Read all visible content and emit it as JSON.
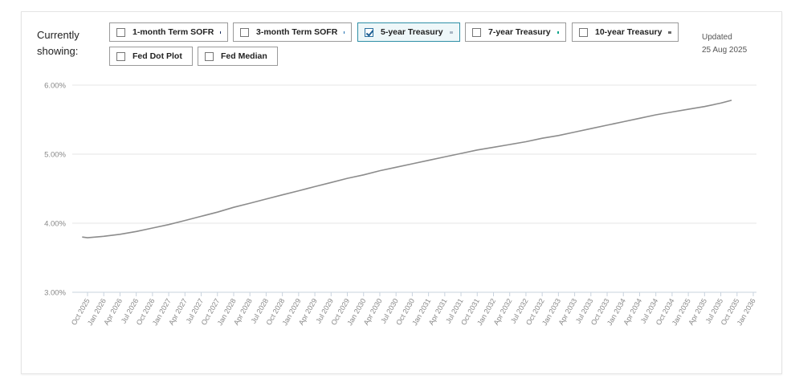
{
  "header": {
    "label_line1": "Currently",
    "label_line2": "showing:",
    "updated_label": "Updated",
    "updated_date": "25 Aug 2025"
  },
  "legend": [
    {
      "label": "1-month Term SOFR",
      "checked": false,
      "marker": "line",
      "color": "#1b2f5e"
    },
    {
      "label": "3-month Term SOFR",
      "checked": false,
      "marker": "line",
      "color": "#1f6fb0"
    },
    {
      "label": "5-year Treasury",
      "checked": true,
      "marker": "line",
      "color": "#a9b6c4"
    },
    {
      "label": "7-year Treasury",
      "checked": false,
      "marker": "line",
      "color": "#12a58c"
    },
    {
      "label": "10-year Treasury",
      "checked": false,
      "marker": "line",
      "color": "#6a6a6a"
    },
    {
      "label": "Fed Dot Plot",
      "checked": false,
      "marker": "dot",
      "color": "#666666"
    },
    {
      "label": "Fed Median",
      "checked": false,
      "marker": "dot",
      "color": "#1aa0c8"
    }
  ],
  "chart_data": {
    "type": "line",
    "title": "",
    "xlabel": "",
    "ylabel": "",
    "ylim": [
      3.0,
      6.0
    ],
    "y_ticks": [
      "3.00%",
      "4.00%",
      "5.00%",
      "6.00%"
    ],
    "x_ticks": [
      "Oct 2025",
      "Jan 2026",
      "Apr 2026",
      "Jul 2026",
      "Oct 2026",
      "Jan 2027",
      "Apr 2027",
      "Jul 2027",
      "Oct 2027",
      "Jan 2028",
      "Apr 2028",
      "Jul 2028",
      "Oct 2028",
      "Jan 2029",
      "Apr 2029",
      "Jul 2029",
      "Oct 2029",
      "Jan 2030",
      "Apr 2030",
      "Jul 2030",
      "Oct 2030",
      "Jan 2031",
      "Apr 2031",
      "Jul 2031",
      "Oct 2031",
      "Jan 2032",
      "Apr 2032",
      "Jul 2032",
      "Oct 2032",
      "Jan 2033",
      "Apr 2033",
      "Jul 2033",
      "Oct 2033",
      "Jan 2034",
      "Apr 2034",
      "Jul 2034",
      "Oct 2034",
      "Jan 2035",
      "Apr 2035",
      "Jul 2035",
      "Oct 2035",
      "Jan 2036"
    ],
    "grid": true,
    "series": [
      {
        "color": "#8c8c8c",
        "x": [
          "Sep 2025",
          "Oct 2025",
          "Jan 2026",
          "Apr 2026",
          "Jul 2026",
          "Oct 2026",
          "Jan 2027",
          "Apr 2027",
          "Jul 2027",
          "Oct 2027",
          "Jan 2028",
          "Apr 2028",
          "Jul 2028",
          "Oct 2028",
          "Jan 2029",
          "Apr 2029",
          "Jul 2029",
          "Oct 2029",
          "Jan 2030",
          "Apr 2030",
          "Jul 2030",
          "Oct 2030",
          "Jan 2031",
          "Apr 2031",
          "Jul 2031",
          "Oct 2031",
          "Jan 2032",
          "Apr 2032",
          "Jul 2032",
          "Oct 2032",
          "Jan 2033",
          "Apr 2033",
          "Jul 2033",
          "Oct 2033",
          "Jan 2034",
          "Apr 2034",
          "Jul 2034",
          "Oct 2034",
          "Jan 2035",
          "Apr 2035",
          "Jul 2035",
          "Sep 2035"
        ],
        "values": [
          3.8,
          3.79,
          3.81,
          3.84,
          3.88,
          3.93,
          3.98,
          4.04,
          4.1,
          4.16,
          4.23,
          4.29,
          4.35,
          4.41,
          4.47,
          4.53,
          4.59,
          4.65,
          4.7,
          4.76,
          4.81,
          4.86,
          4.91,
          4.96,
          5.01,
          5.06,
          5.1,
          5.14,
          5.18,
          5.23,
          5.27,
          5.32,
          5.37,
          5.42,
          5.47,
          5.52,
          5.57,
          5.61,
          5.65,
          5.69,
          5.74,
          5.78
        ]
      }
    ]
  }
}
